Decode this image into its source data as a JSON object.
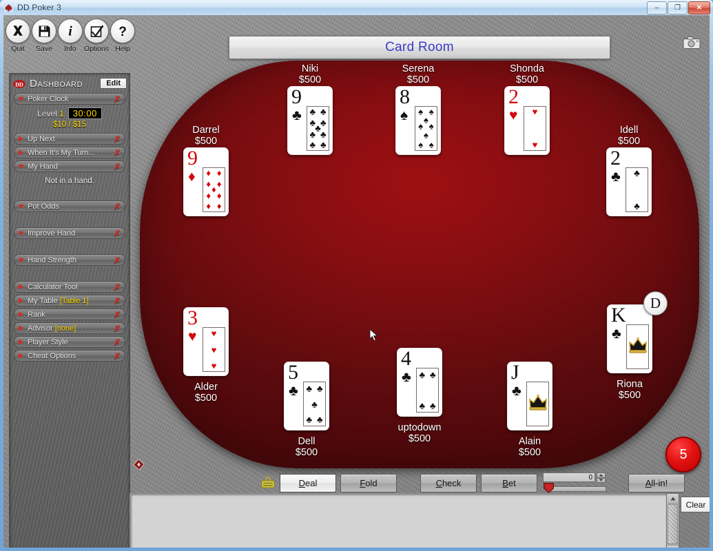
{
  "window": {
    "title": "DD Poker 3",
    "icon": "spade-logo-icon",
    "buttons": {
      "minimize": "–",
      "maximize": "❐",
      "close": "✕"
    }
  },
  "toolbar": {
    "items": [
      {
        "label": "Quit",
        "icon": "x-icon"
      },
      {
        "label": "Save",
        "icon": "floppy-disk-icon"
      },
      {
        "label": "Info",
        "icon": "info-icon"
      },
      {
        "label": "Options",
        "icon": "checkbox-check-icon"
      },
      {
        "label": "Help",
        "icon": "question-mark-icon"
      }
    ]
  },
  "dashboard": {
    "title": "Dashboard",
    "edit_label": "Edit",
    "logo_icon": "dd-poker-logo-icon",
    "clock": {
      "header": "Poker Clock",
      "level_label": "Level",
      "level_value": "1",
      "time": "30:00",
      "blinds": "$10 / $15"
    },
    "my_hand_note": "Not in a hand.",
    "sections": [
      {
        "label": "Up Next",
        "state": "collapsed"
      },
      {
        "label": "When It's My Turn...",
        "state": "collapsed"
      },
      {
        "label": "My Hand",
        "state": "expanded"
      },
      {
        "label": "Pot Odds",
        "state": "expanded"
      },
      {
        "label": "Improve Hand",
        "state": "expanded"
      },
      {
        "label": "Hand Strength",
        "state": "expanded"
      },
      {
        "label": "Calculator Tool",
        "state": "collapsed"
      },
      {
        "label": "My Table ",
        "highlight": "[Table 1]",
        "state": "collapsed"
      },
      {
        "label": "Rank",
        "state": "collapsed"
      },
      {
        "label": "Advisor ",
        "highlight": "[none]",
        "state": "collapsed"
      },
      {
        "label": "Player Style",
        "state": "collapsed"
      },
      {
        "label": "Cheat Options",
        "state": "collapsed"
      }
    ],
    "close_glyph": "✗"
  },
  "room": {
    "title": "Card Room",
    "camera_icon": "camera-icon",
    "observer_count": "5"
  },
  "seats": [
    {
      "name": "Niki",
      "chips": "$500",
      "card": {
        "rank": "9",
        "suit": "clubs",
        "color": "black"
      },
      "dealer": false,
      "label_position": "above"
    },
    {
      "name": "Serena",
      "chips": "$500",
      "card": {
        "rank": "8",
        "suit": "spades",
        "color": "black"
      },
      "dealer": false,
      "label_position": "above"
    },
    {
      "name": "Shonda",
      "chips": "$500",
      "card": {
        "rank": "2",
        "suit": "hearts",
        "color": "red"
      },
      "dealer": false,
      "label_position": "above"
    },
    {
      "name": "Idell",
      "chips": "$500",
      "card": {
        "rank": "2",
        "suit": "clubs",
        "color": "black"
      },
      "dealer": false,
      "label_position": "above"
    },
    {
      "name": "Darrel",
      "chips": "$500",
      "card": {
        "rank": "9",
        "suit": "diamonds",
        "color": "red"
      },
      "dealer": false,
      "label_position": "above"
    },
    {
      "name": "Alder",
      "chips": "$500",
      "card": {
        "rank": "3",
        "suit": "hearts",
        "color": "red"
      },
      "dealer": false,
      "label_position": "below"
    },
    {
      "name": "Dell",
      "chips": "$500",
      "card": {
        "rank": "5",
        "suit": "clubs",
        "color": "black"
      },
      "dealer": false,
      "label_position": "below"
    },
    {
      "name": "uptodown",
      "chips": "$500",
      "card": {
        "rank": "4",
        "suit": "clubs",
        "color": "black"
      },
      "dealer": false,
      "label_position": "below"
    },
    {
      "name": "Alain",
      "chips": "$500",
      "card": {
        "rank": "J",
        "suit": "clubs",
        "color": "black"
      },
      "dealer": false,
      "label_position": "below"
    },
    {
      "name": "Riona",
      "chips": "$500",
      "card": {
        "rank": "K",
        "suit": "clubs",
        "color": "black"
      },
      "dealer": true,
      "label_position": "below"
    }
  ],
  "dealer_button_label": "D",
  "actions": {
    "chip_icon": "poker-chip-icon",
    "buttons": [
      {
        "label": "Deal",
        "mnemonic": "D",
        "primary": true
      },
      {
        "label": "Fold",
        "mnemonic": "F",
        "primary": false
      },
      {
        "label": "Check",
        "mnemonic": "C",
        "primary": false
      },
      {
        "label": "Bet",
        "mnemonic": "B",
        "primary": false
      },
      {
        "label": "All-in!",
        "mnemonic": "A",
        "primary": false
      }
    ],
    "bet_amount": "0",
    "slider_value": "0"
  },
  "chat": {
    "messages": "",
    "clear_label": "Clear"
  },
  "colors": {
    "table_felt": "#8c0e11",
    "title_blue": "#3c3cc8",
    "highlight_yellow": "#ffd800",
    "close_red": "#d42a22",
    "badge_red": "#e41212"
  }
}
